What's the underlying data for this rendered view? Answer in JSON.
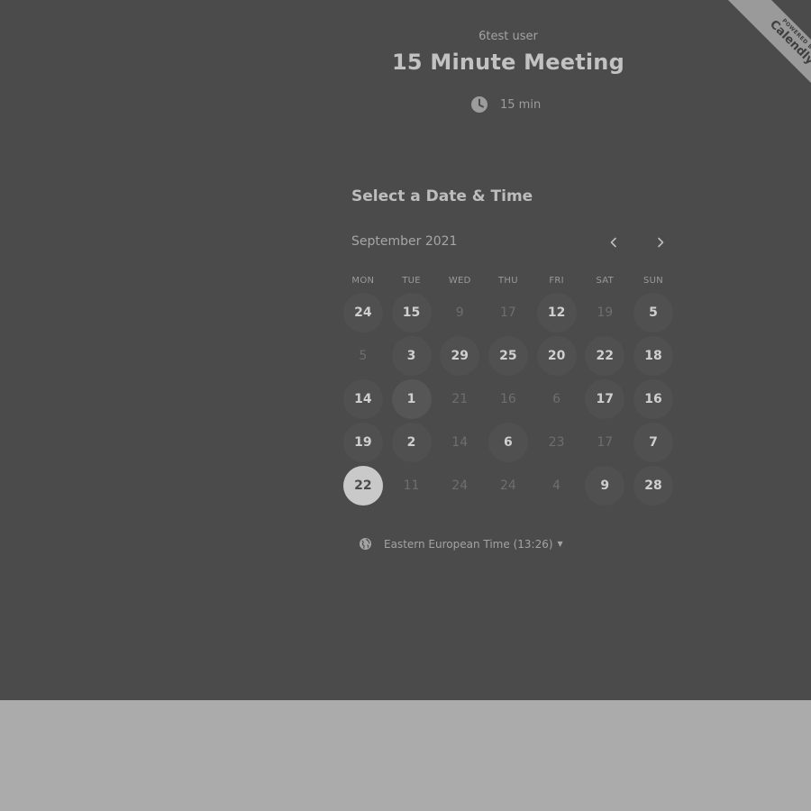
{
  "header": {
    "host_name": "6test user",
    "event_title": "15 Minute Meeting",
    "duration_label": "15 min"
  },
  "ribbon": {
    "powered_by": "POWERED BY",
    "brand": "Calendly"
  },
  "calendar": {
    "heading": "Select a Date & Time",
    "month_label": "September 2021",
    "weekdays": [
      "MON",
      "TUE",
      "WED",
      "THU",
      "FRI",
      "SAT",
      "SUN"
    ],
    "weeks": [
      [
        {
          "label": "24",
          "state": "avail"
        },
        {
          "label": "15",
          "state": "avail"
        },
        {
          "label": "9",
          "state": "unavail"
        },
        {
          "label": "17",
          "state": "unavail"
        },
        {
          "label": "12",
          "state": "avail"
        },
        {
          "label": "19",
          "state": "unavail"
        },
        {
          "label": "5",
          "state": "avail"
        }
      ],
      [
        {
          "label": "5",
          "state": "unavail"
        },
        {
          "label": "3",
          "state": "avail"
        },
        {
          "label": "29",
          "state": "avail"
        },
        {
          "label": "25",
          "state": "avail"
        },
        {
          "label": "20",
          "state": "avail"
        },
        {
          "label": "22",
          "state": "avail"
        },
        {
          "label": "18",
          "state": "avail"
        }
      ],
      [
        {
          "label": "14",
          "state": "avail"
        },
        {
          "label": "1",
          "state": "today"
        },
        {
          "label": "21",
          "state": "unavail"
        },
        {
          "label": "16",
          "state": "unavail"
        },
        {
          "label": "6",
          "state": "unavail"
        },
        {
          "label": "17",
          "state": "avail"
        },
        {
          "label": "16",
          "state": "avail"
        }
      ],
      [
        {
          "label": "19",
          "state": "avail"
        },
        {
          "label": "2",
          "state": "avail"
        },
        {
          "label": "14",
          "state": "unavail"
        },
        {
          "label": "6",
          "state": "avail"
        },
        {
          "label": "23",
          "state": "unavail"
        },
        {
          "label": "17",
          "state": "unavail"
        },
        {
          "label": "7",
          "state": "avail"
        }
      ],
      [
        {
          "label": "22",
          "state": "selected"
        },
        {
          "label": "11",
          "state": "unavail"
        },
        {
          "label": "24",
          "state": "unavail"
        },
        {
          "label": "24",
          "state": "unavail"
        },
        {
          "label": "4",
          "state": "unavail"
        },
        {
          "label": "9",
          "state": "avail"
        },
        {
          "label": "28",
          "state": "avail"
        }
      ]
    ]
  },
  "timezone": {
    "label": "Eastern European Time (13:26)"
  },
  "icons": {
    "clock": "clock-icon",
    "globe": "globe-icon",
    "prev": "chevron-left-icon",
    "next": "chevron-right-icon",
    "caret": "caret-down-icon"
  }
}
